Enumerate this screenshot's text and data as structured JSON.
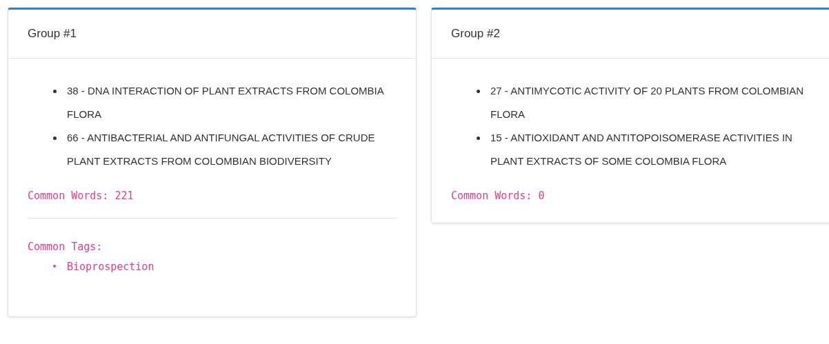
{
  "groups": [
    {
      "title": "Group #1",
      "papers": [
        "38 - DNA INTERACTION OF PLANT EXTRACTS FROM COLOMBIA FLORA",
        "66 - ANTIBACTERIAL AND ANTIFUNGAL ACTIVITIES OF CRUDE PLANT EXTRACTS FROM COLOMBIAN BIODIVERSITY"
      ],
      "common_words": "Common Words: 221",
      "common_tags": {
        "label": "Common Tags:",
        "tags": [
          "Bioprospection"
        ]
      }
    },
    {
      "title": "Group #2",
      "papers": [
        "27 - ANTIMYCOTIC ACTIVITY OF 20 PLANTS FROM COLOMBIAN FLORA",
        "15 - ANTIOXIDANT AND ANTITOPOISOMERASE ACTIVITIES IN PLANT EXTRACTS OF SOME COLOMBIA FLORA"
      ],
      "common_words": "Common Words: 0"
    }
  ]
}
